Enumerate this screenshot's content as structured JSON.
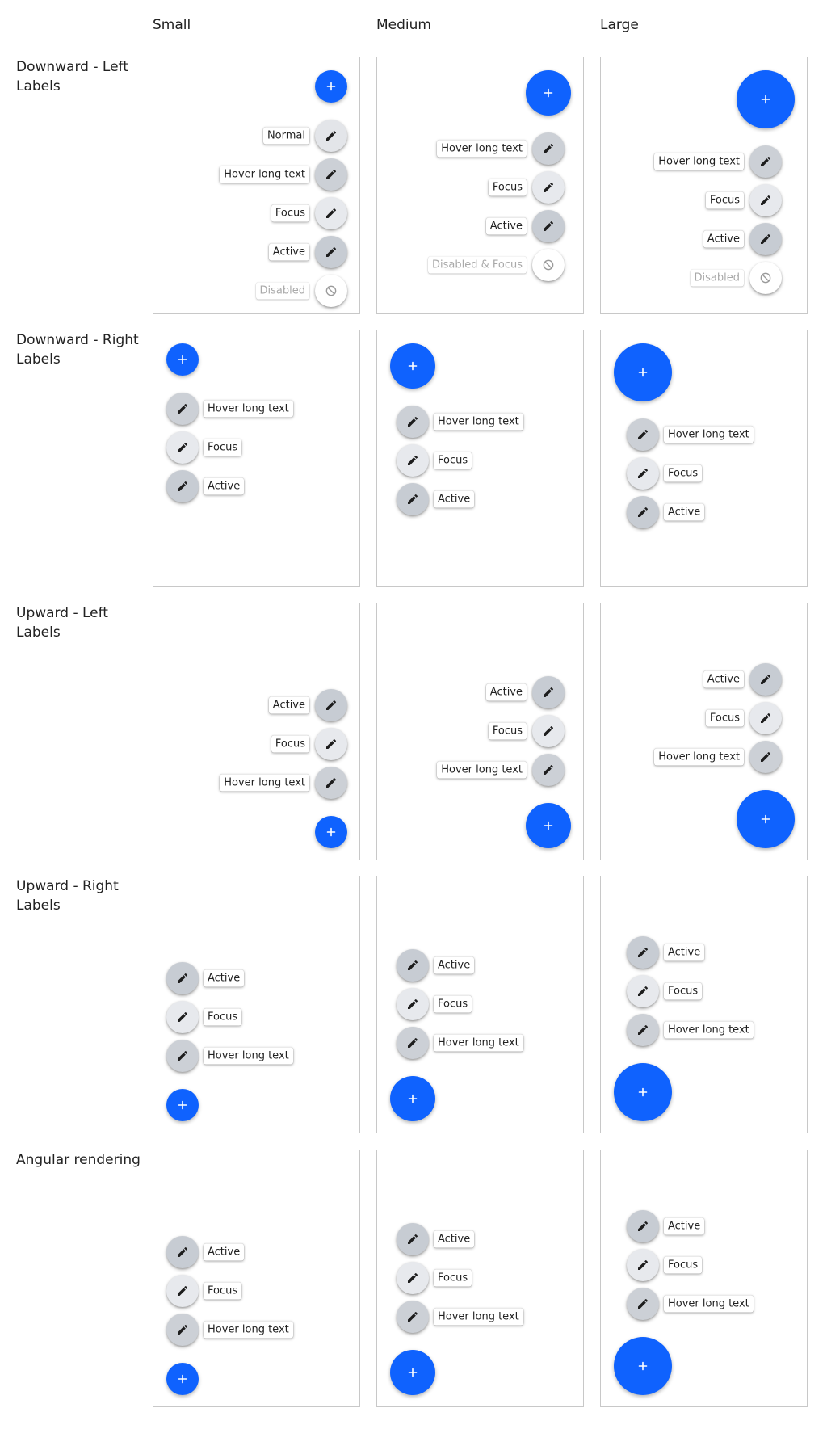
{
  "columns": [
    "Small",
    "Medium",
    "Large"
  ],
  "rows": [
    {
      "label": "Downward - Left Labels",
      "cells": [
        [
          {
            "label": "Normal",
            "state": "normal"
          },
          {
            "label": "Hover long text",
            "state": "hover"
          },
          {
            "label": "Focus",
            "state": "focus"
          },
          {
            "label": "Active",
            "state": "active"
          },
          {
            "label": "Disabled",
            "state": "disabled"
          }
        ],
        [
          {
            "label": "Hover long text",
            "state": "hover"
          },
          {
            "label": "Focus",
            "state": "focus"
          },
          {
            "label": "Active",
            "state": "active"
          },
          {
            "label": "Disabled & Focus",
            "state": "disabled"
          }
        ],
        [
          {
            "label": "Hover long text",
            "state": "hover"
          },
          {
            "label": "Focus",
            "state": "focus"
          },
          {
            "label": "Active",
            "state": "active"
          },
          {
            "label": "Disabled",
            "state": "disabled"
          }
        ]
      ]
    },
    {
      "label": "Downward - Right Labels",
      "cells": [
        [
          {
            "label": "Hover long text",
            "state": "hover"
          },
          {
            "label": "Focus",
            "state": "focus"
          },
          {
            "label": "Active",
            "state": "active"
          }
        ],
        [
          {
            "label": "Hover long text",
            "state": "hover"
          },
          {
            "label": "Focus",
            "state": "focus"
          },
          {
            "label": "Active",
            "state": "active"
          }
        ],
        [
          {
            "label": "Hover long text",
            "state": "hover"
          },
          {
            "label": "Focus",
            "state": "focus"
          },
          {
            "label": "Active",
            "state": "active"
          }
        ]
      ]
    },
    {
      "label": "Upward - Left Labels",
      "cells": [
        [
          {
            "label": "Active",
            "state": "active"
          },
          {
            "label": "Focus",
            "state": "focus"
          },
          {
            "label": "Hover long text",
            "state": "hover"
          }
        ],
        [
          {
            "label": "Active",
            "state": "active"
          },
          {
            "label": "Focus",
            "state": "focus"
          },
          {
            "label": "Hover long text",
            "state": "hover"
          }
        ],
        [
          {
            "label": "Active",
            "state": "active"
          },
          {
            "label": "Focus",
            "state": "focus"
          },
          {
            "label": "Hover long text",
            "state": "hover"
          }
        ]
      ]
    },
    {
      "label": "Upward - Right Labels",
      "cells": [
        [
          {
            "label": "Active",
            "state": "active"
          },
          {
            "label": "Focus",
            "state": "focus"
          },
          {
            "label": "Hover long text",
            "state": "hover"
          }
        ],
        [
          {
            "label": "Active",
            "state": "active"
          },
          {
            "label": "Focus",
            "state": "focus"
          },
          {
            "label": "Hover long text",
            "state": "hover"
          }
        ],
        [
          {
            "label": "Active",
            "state": "active"
          },
          {
            "label": "Focus",
            "state": "focus"
          },
          {
            "label": "Hover long text",
            "state": "hover"
          }
        ]
      ]
    },
    {
      "label": "Angular rendering",
      "cells": [
        [
          {
            "label": "Active",
            "state": "active"
          },
          {
            "label": "Focus",
            "state": "focus"
          },
          {
            "label": "Hover long text",
            "state": "hover"
          }
        ],
        [
          {
            "label": "Active",
            "state": "active"
          },
          {
            "label": "Focus",
            "state": "focus"
          },
          {
            "label": "Hover long text",
            "state": "hover"
          }
        ],
        [
          {
            "label": "Active",
            "state": "active"
          },
          {
            "label": "Focus",
            "state": "focus"
          },
          {
            "label": "Hover long text",
            "state": "hover"
          }
        ]
      ]
    }
  ],
  "icons": {
    "main": "plus-icon",
    "item": "pencil-icon",
    "disabled": "no-entry-icon"
  },
  "colors": {
    "fab": "#0f62fe",
    "fab_icon": "#ffffff"
  }
}
